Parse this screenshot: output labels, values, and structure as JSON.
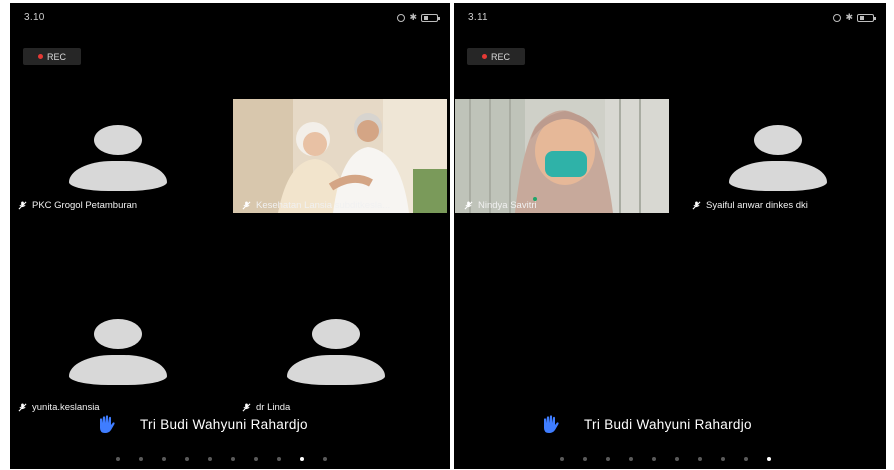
{
  "left_screen": {
    "time": "3.10",
    "status_icons": [
      "wifi-icon",
      "alarm-icon",
      "bluetooth-icon",
      "battery-icon"
    ],
    "rec_label": "REC",
    "tiles": [
      {
        "name": "PKC Grogol Petamburan",
        "type": "avatar"
      },
      {
        "name": "Kesehatan Lansia subditkesla...",
        "type": "video"
      },
      {
        "name": "yunita.keslansia",
        "type": "avatar"
      },
      {
        "name": "dr Linda",
        "type": "avatar"
      }
    ],
    "raised_hand_name": "Tri Budi Wahyuni Rahardjo",
    "page_count": 10,
    "active_page": 9
  },
  "right_screen": {
    "time": "3.11",
    "status_icons": [
      "wifi-icon",
      "alarm-icon",
      "bluetooth-icon",
      "battery-icon"
    ],
    "rec_label": "REC",
    "tiles": [
      {
        "name": "Nindya Savitri",
        "type": "video"
      },
      {
        "name": "Syaiful anwar dinkes dki",
        "type": "avatar"
      }
    ],
    "raised_hand_name": "Tri Budi Wahyuni Rahardjo",
    "page_count": 10,
    "active_page": 10
  },
  "colors": {
    "background": "#000000",
    "avatar": "#d8d8d8",
    "rec_dot": "#e53935",
    "hand": "#3f7dff"
  }
}
